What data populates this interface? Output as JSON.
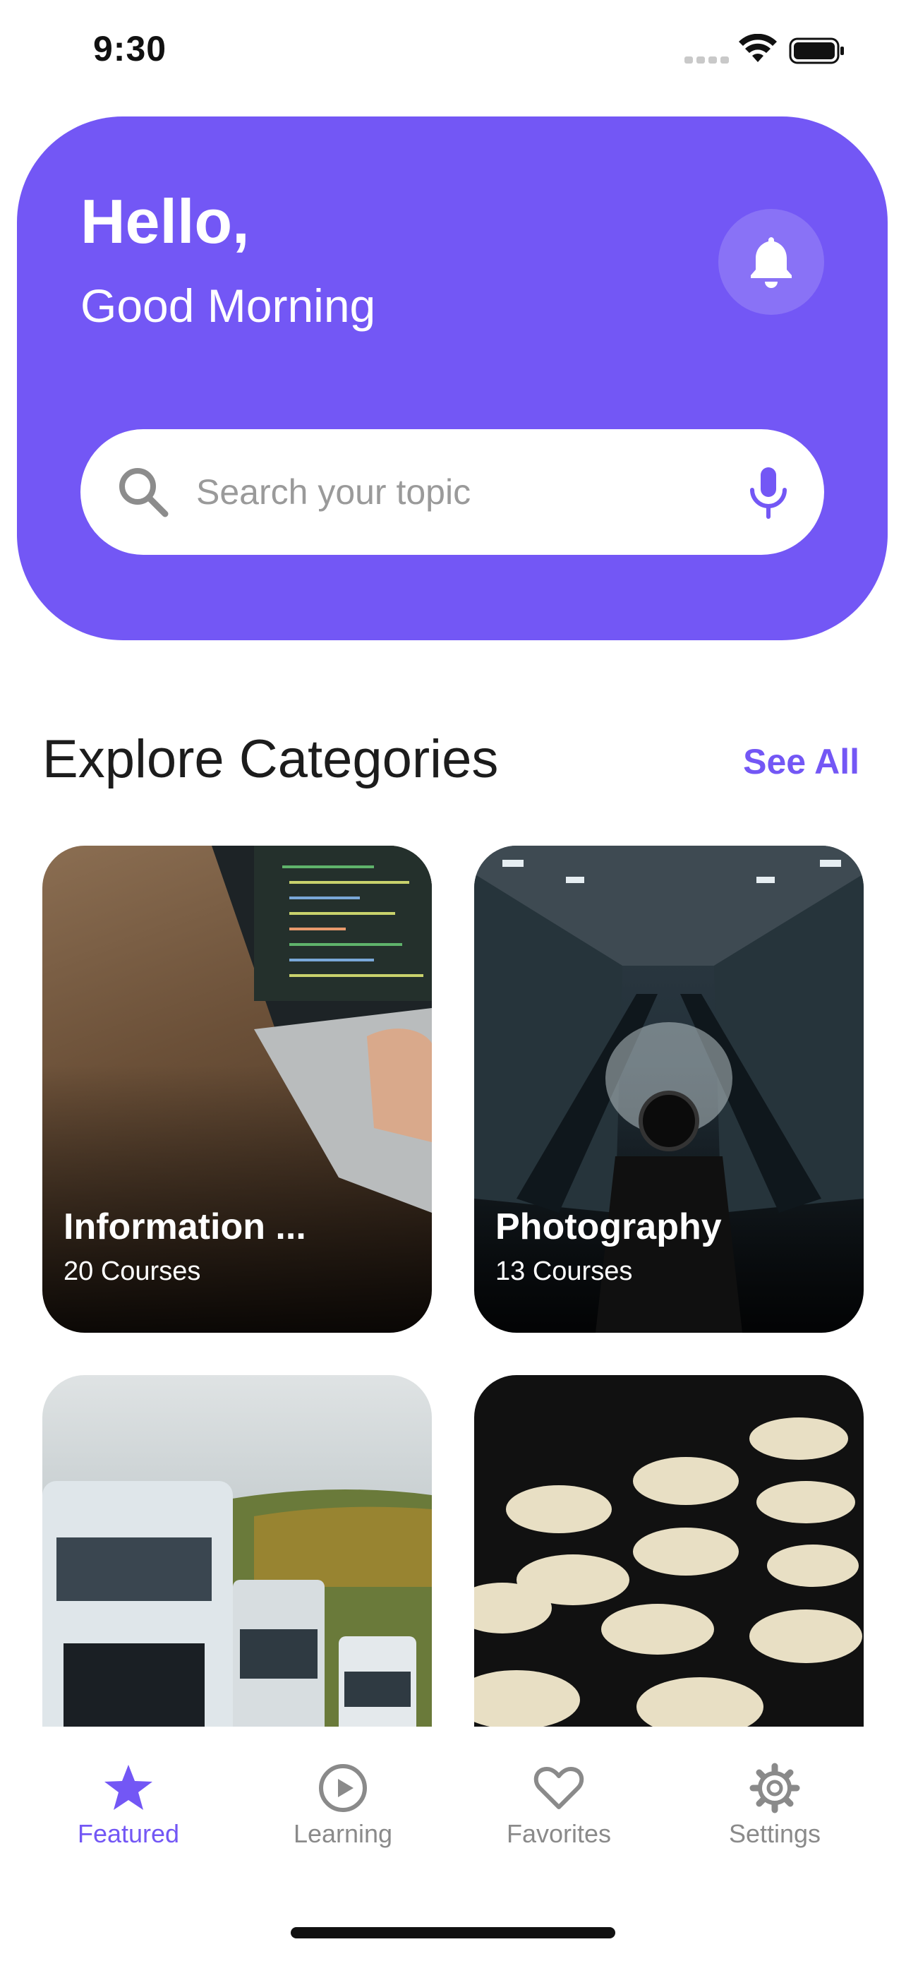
{
  "status_bar": {
    "time": "9:30"
  },
  "header": {
    "greeting": "Hello,",
    "sub_greeting": "Good Morning",
    "accent_color": "#7357F5",
    "bell_icon": "bell-icon"
  },
  "search": {
    "placeholder": "Search your topic",
    "value": "",
    "left_icon": "search-icon",
    "right_icon": "mic-icon"
  },
  "section": {
    "title": "Explore Categories",
    "see_all_label": "See All"
  },
  "categories": [
    {
      "title": "Information ...",
      "count": "20 Courses"
    },
    {
      "title": "Photography",
      "count": "13 Courses"
    },
    {
      "title": "",
      "count": ""
    },
    {
      "title": "",
      "count": ""
    }
  ],
  "nav": {
    "items": [
      {
        "label": "Featured",
        "icon": "star-icon",
        "active": true
      },
      {
        "label": "Learning",
        "icon": "play-circle-icon",
        "active": false
      },
      {
        "label": "Favorites",
        "icon": "heart-icon",
        "active": false
      },
      {
        "label": "Settings",
        "icon": "gear-icon",
        "active": false
      }
    ],
    "active_color": "#7357F5",
    "inactive_color": "#8a8a8a"
  }
}
